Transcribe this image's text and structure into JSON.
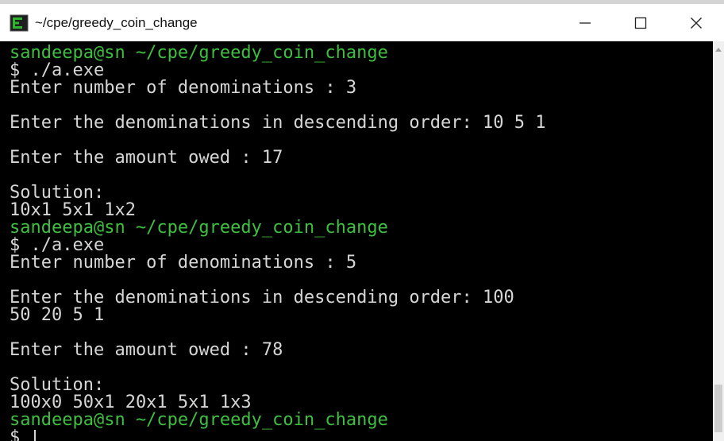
{
  "window": {
    "title": "~/cpe/greedy_coin_change",
    "icon": "terminal-app-icon",
    "controls": [
      "minimize-icon",
      "maximize-icon",
      "close-icon"
    ]
  },
  "terminal": {
    "lines": [
      {
        "kind": "prompt",
        "text": "sandeepa@sn ~/cpe/greedy_coin_change"
      },
      {
        "kind": "output",
        "text": "$ ./a.exe"
      },
      {
        "kind": "output",
        "text": "Enter number of denominations : 3"
      },
      {
        "kind": "output",
        "text": ""
      },
      {
        "kind": "output",
        "text": "Enter the denominations in descending order: 10 5 1"
      },
      {
        "kind": "output",
        "text": ""
      },
      {
        "kind": "output",
        "text": "Enter the amount owed : 17"
      },
      {
        "kind": "output",
        "text": ""
      },
      {
        "kind": "output",
        "text": "Solution:"
      },
      {
        "kind": "output",
        "text": "10x1 5x1 1x2"
      },
      {
        "kind": "prompt",
        "text": "sandeepa@sn ~/cpe/greedy_coin_change"
      },
      {
        "kind": "output",
        "text": "$ ./a.exe"
      },
      {
        "kind": "output",
        "text": "Enter number of denominations : 5"
      },
      {
        "kind": "output",
        "text": ""
      },
      {
        "kind": "output",
        "text": "Enter the denominations in descending order: 100"
      },
      {
        "kind": "output",
        "text": "50 20 5 1"
      },
      {
        "kind": "output",
        "text": ""
      },
      {
        "kind": "output",
        "text": "Enter the amount owed : 78"
      },
      {
        "kind": "output",
        "text": ""
      },
      {
        "kind": "output",
        "text": "Solution:"
      },
      {
        "kind": "output",
        "text": "100x0 50x1 20x1 5x1 1x3"
      },
      {
        "kind": "prompt",
        "text": "sandeepa@sn ~/cpe/greedy_coin_change"
      },
      {
        "kind": "input",
        "text": "$ "
      }
    ]
  },
  "colors": {
    "background": "#000000",
    "text": "#d6d6d6",
    "prompt": "#3fbf3f"
  }
}
